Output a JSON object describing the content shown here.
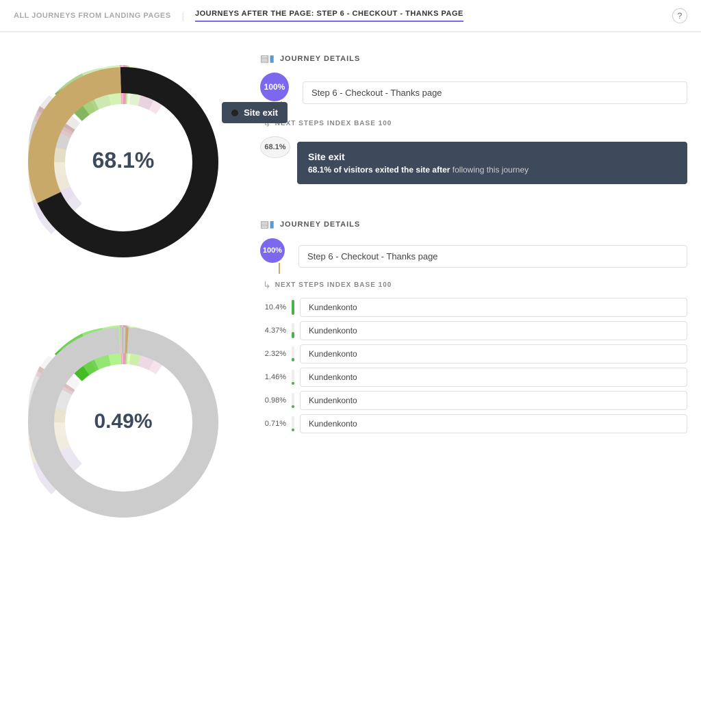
{
  "nav": {
    "all_journeys_label": "ALL JOURNEYS FROM LANDING PAGES",
    "active_label": "JOURNEYS AFTER THE PAGE: STEP 6 - CHECKOUT - THANKS PAGE",
    "help_label": "?"
  },
  "chart1": {
    "center_pct": "68.1%",
    "tooltip_label": "Site exit",
    "outer_color": "#c8a96a",
    "inner_color": "#000"
  },
  "chart2": {
    "center_pct": "0.49%",
    "outer_color": "#c8a96a",
    "inner_color": "#bbb"
  },
  "journey1": {
    "section_title": "JOURNEY DETAILS",
    "node_pct": "100%",
    "node_page": "Step 6 - Checkout - Thanks page",
    "next_steps_label": "NEXT STEPS INDEX BASE 100",
    "exit_pct": "68.1%",
    "exit_title": "Site exit",
    "exit_desc_bold": "68.1% of visitors exited the site after",
    "exit_desc": "following this journey"
  },
  "journey2": {
    "section_title": "JOURNEY DETAILS",
    "node_pct": "100%",
    "node_page": "Step 6 - Checkout - Thanks page",
    "next_steps_label": "NEXT STEPS INDEX BASE 100",
    "steps": [
      {
        "pct": "10.4%",
        "pct_num": 100,
        "name": "Kundenkonto"
      },
      {
        "pct": "4.37%",
        "pct_num": 42,
        "name": "Kundenkonto"
      },
      {
        "pct": "2.32%",
        "pct_num": 22,
        "name": "Kundenkonto"
      },
      {
        "pct": "1.46%",
        "pct_num": 14,
        "name": "Kundenkonto"
      },
      {
        "pct": "0.98%",
        "pct_num": 9,
        "name": "Kundenkonto"
      },
      {
        "pct": "0.71%",
        "pct_num": 7,
        "name": "Kundenkonto"
      }
    ]
  }
}
